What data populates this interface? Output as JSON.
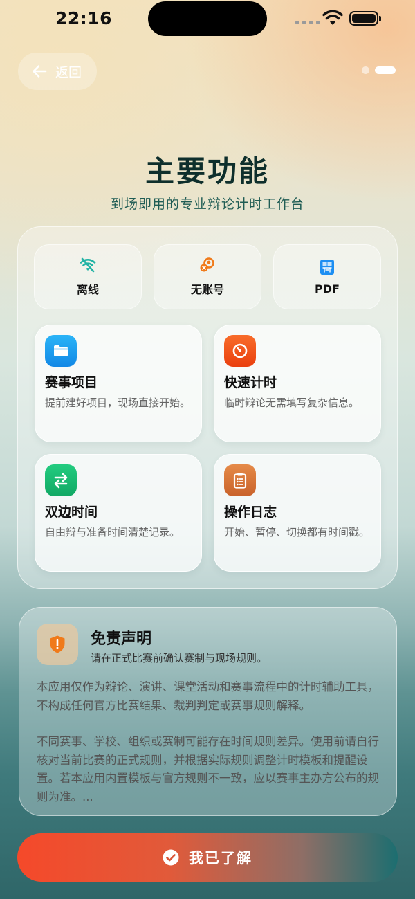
{
  "status_bar": {
    "time": "22:16"
  },
  "header": {
    "back_label": "返回"
  },
  "title": "主要功能",
  "subtitle": "到场即用的专业辩论计时工作台",
  "chips": [
    {
      "label": "离线",
      "icon": "wifi-off-icon",
      "color": "#23b3a5"
    },
    {
      "label": "无账号",
      "icon": "no-account-icon",
      "color": "#f07a1a"
    },
    {
      "label": "PDF",
      "icon": "pdf-icon",
      "color": "#1d8ef2"
    }
  ],
  "cards": [
    {
      "title": "赛事项目",
      "desc": "提前建好项目，现场直接开始。",
      "icon": "folder-icon",
      "color": "#1a9ff0"
    },
    {
      "title": "快速计时",
      "desc": "临时辩论无需填写复杂信息。",
      "icon": "timer-icon",
      "color": "#f2541b"
    },
    {
      "title": "双边时间",
      "desc": "自由辩与准备时间清楚记录。",
      "icon": "swap-arrows-icon",
      "color": "#18b870"
    },
    {
      "title": "操作日志",
      "desc": "开始、暂停、切换都有时间戳。",
      "icon": "clipboard-icon",
      "color": "#d9733a"
    }
  ],
  "disclaimer": {
    "title": "免责声明",
    "subtitle": "请在正式比赛前确认赛制与现场规则。",
    "paragraph1": "本应用仅作为辩论、演讲、课堂活动和赛事流程中的计时辅助工具，不构成任何官方比赛结果、裁判判定或赛事规则解释。",
    "paragraph2": "不同赛事、学校、组织或赛制可能存在时间规则差异。使用前请自行核对当前比赛的正式规则，并根据实际规则调整计时模板和提醒设置。若本应用内置模板与官方规则不一致，应以赛事主办方公布的规则为准。..."
  },
  "action": {
    "label": "我已了解"
  }
}
